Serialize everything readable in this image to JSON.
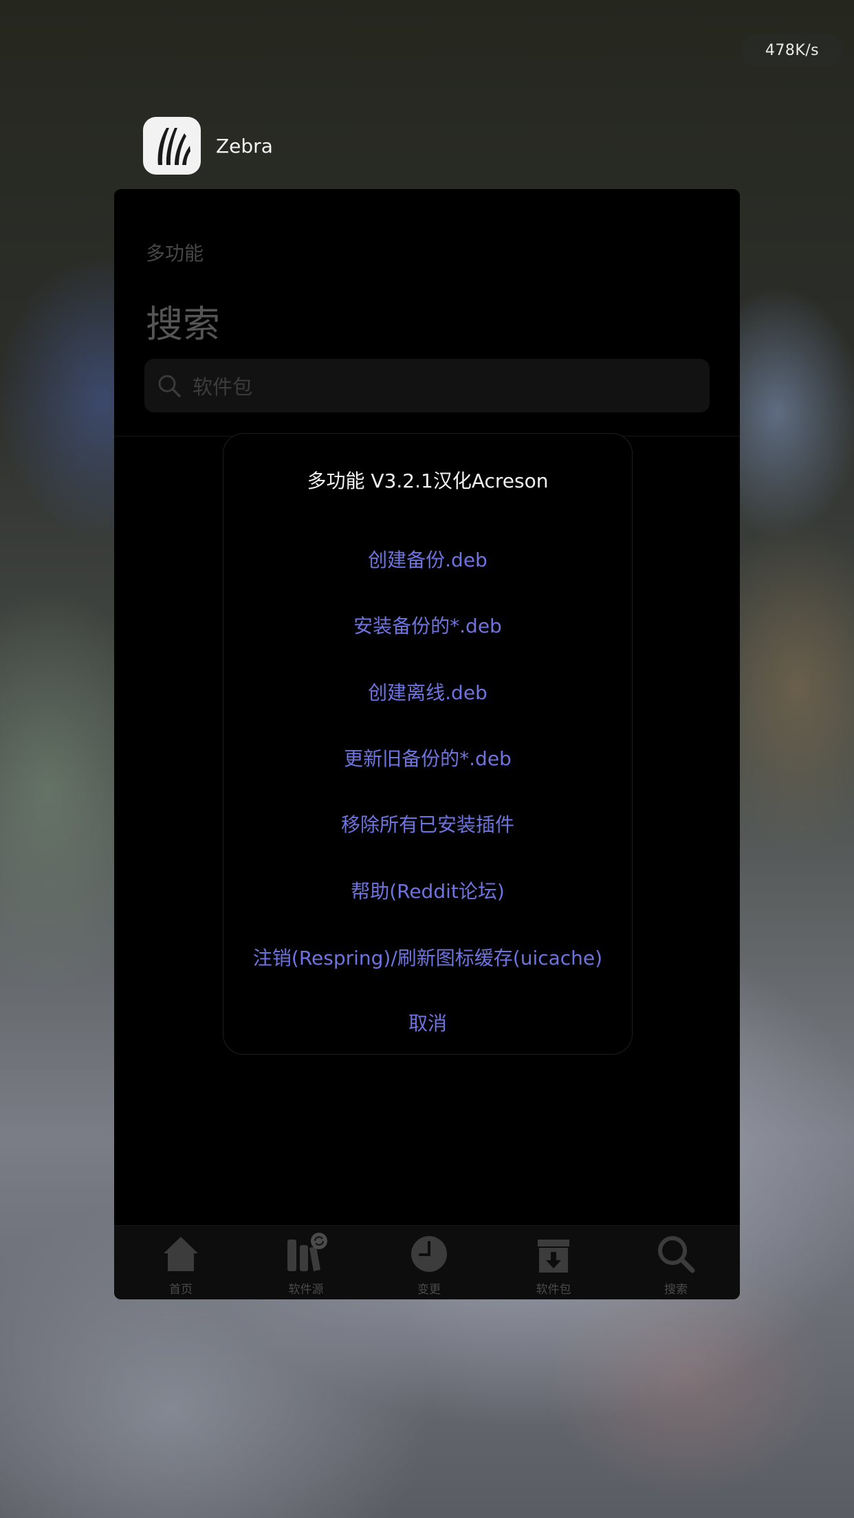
{
  "status_bar": {
    "network_speed": "478K/s"
  },
  "app_switcher": {
    "app_name": "Zebra",
    "icon": "zebra-stripes-icon"
  },
  "screen": {
    "nav_small_title": "多功能",
    "nav_large_title": "搜索",
    "search": {
      "placeholder": "软件包",
      "icon": "search-icon"
    },
    "tab_bar": {
      "items": [
        {
          "label": "首页",
          "icon": "home-icon"
        },
        {
          "label": "软件源",
          "icon": "sources-refresh-icon"
        },
        {
          "label": "变更",
          "icon": "clock-icon"
        },
        {
          "label": "软件包",
          "icon": "package-download-icon"
        },
        {
          "label": "搜索",
          "icon": "search-icon"
        }
      ]
    }
  },
  "action_sheet": {
    "title": "多功能 V3.2.1汉化Acreson",
    "options": [
      "创建备份.deb",
      "安装备份的*.deb",
      "创建离线.deb",
      "更新旧备份的*.deb",
      "移除所有已安装插件",
      "帮助(Reddit论坛)",
      "注销(Respring)/刷新图标缓存(uicache)"
    ],
    "cancel": "取消",
    "accent_color": "#6d74e0"
  }
}
